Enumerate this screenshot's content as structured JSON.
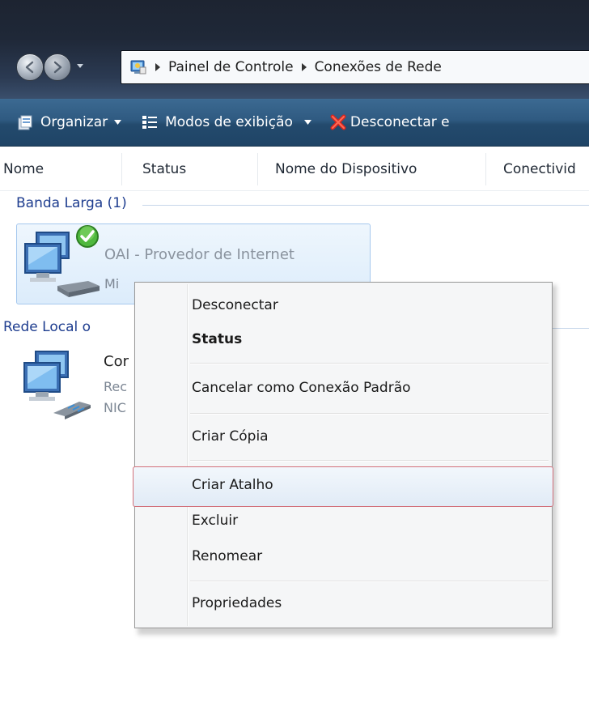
{
  "address_bar": {
    "crumbs": [
      "Painel de Controle",
      "Conexões de Rede"
    ]
  },
  "toolbar": {
    "organize": "Organizar",
    "views": "Modos de exibição",
    "disconnect": "Desconectar e"
  },
  "columns": [
    "Nome",
    "Status",
    "Nome do Dispositivo",
    "Conectivid"
  ],
  "groups": {
    "broadband": {
      "title": "Banda Larga (1)",
      "item": {
        "name": "OAI - Provedor de Internet",
        "sub": "Mi",
        "status_badge": "connected"
      }
    },
    "lan": {
      "title": "Rede Local o",
      "item": {
        "name": "Cor",
        "sub1": "Rec",
        "sub2": "NIC"
      }
    }
  },
  "context_menu": {
    "items": [
      {
        "label": "Desconectar",
        "bold": false
      },
      {
        "label": "Status",
        "bold": true
      },
      {
        "label": "Cancelar como Conexão Padrão",
        "bold": false
      },
      {
        "label": "Criar Cópia",
        "bold": false
      },
      {
        "label": "Criar Atalho",
        "bold": false,
        "highlighted": true
      },
      {
        "label": "Excluir",
        "bold": false
      },
      {
        "label": "Renomear",
        "bold": false
      },
      {
        "label": "Propriedades",
        "bold": false
      }
    ]
  },
  "colors": {
    "toolbar_bg": "#2f5a81",
    "group_title": "#1e3d8f",
    "menu_highlight_border": "#d2707a"
  },
  "icons": [
    "back-icon",
    "forward-icon",
    "control-panel-icon",
    "breadcrumb-arrow-icon",
    "organize-icon",
    "views-icon",
    "disconnect-icon",
    "network-computer-icon",
    "connected-check-icon",
    "modem-icon",
    "network-cable-icon"
  ]
}
